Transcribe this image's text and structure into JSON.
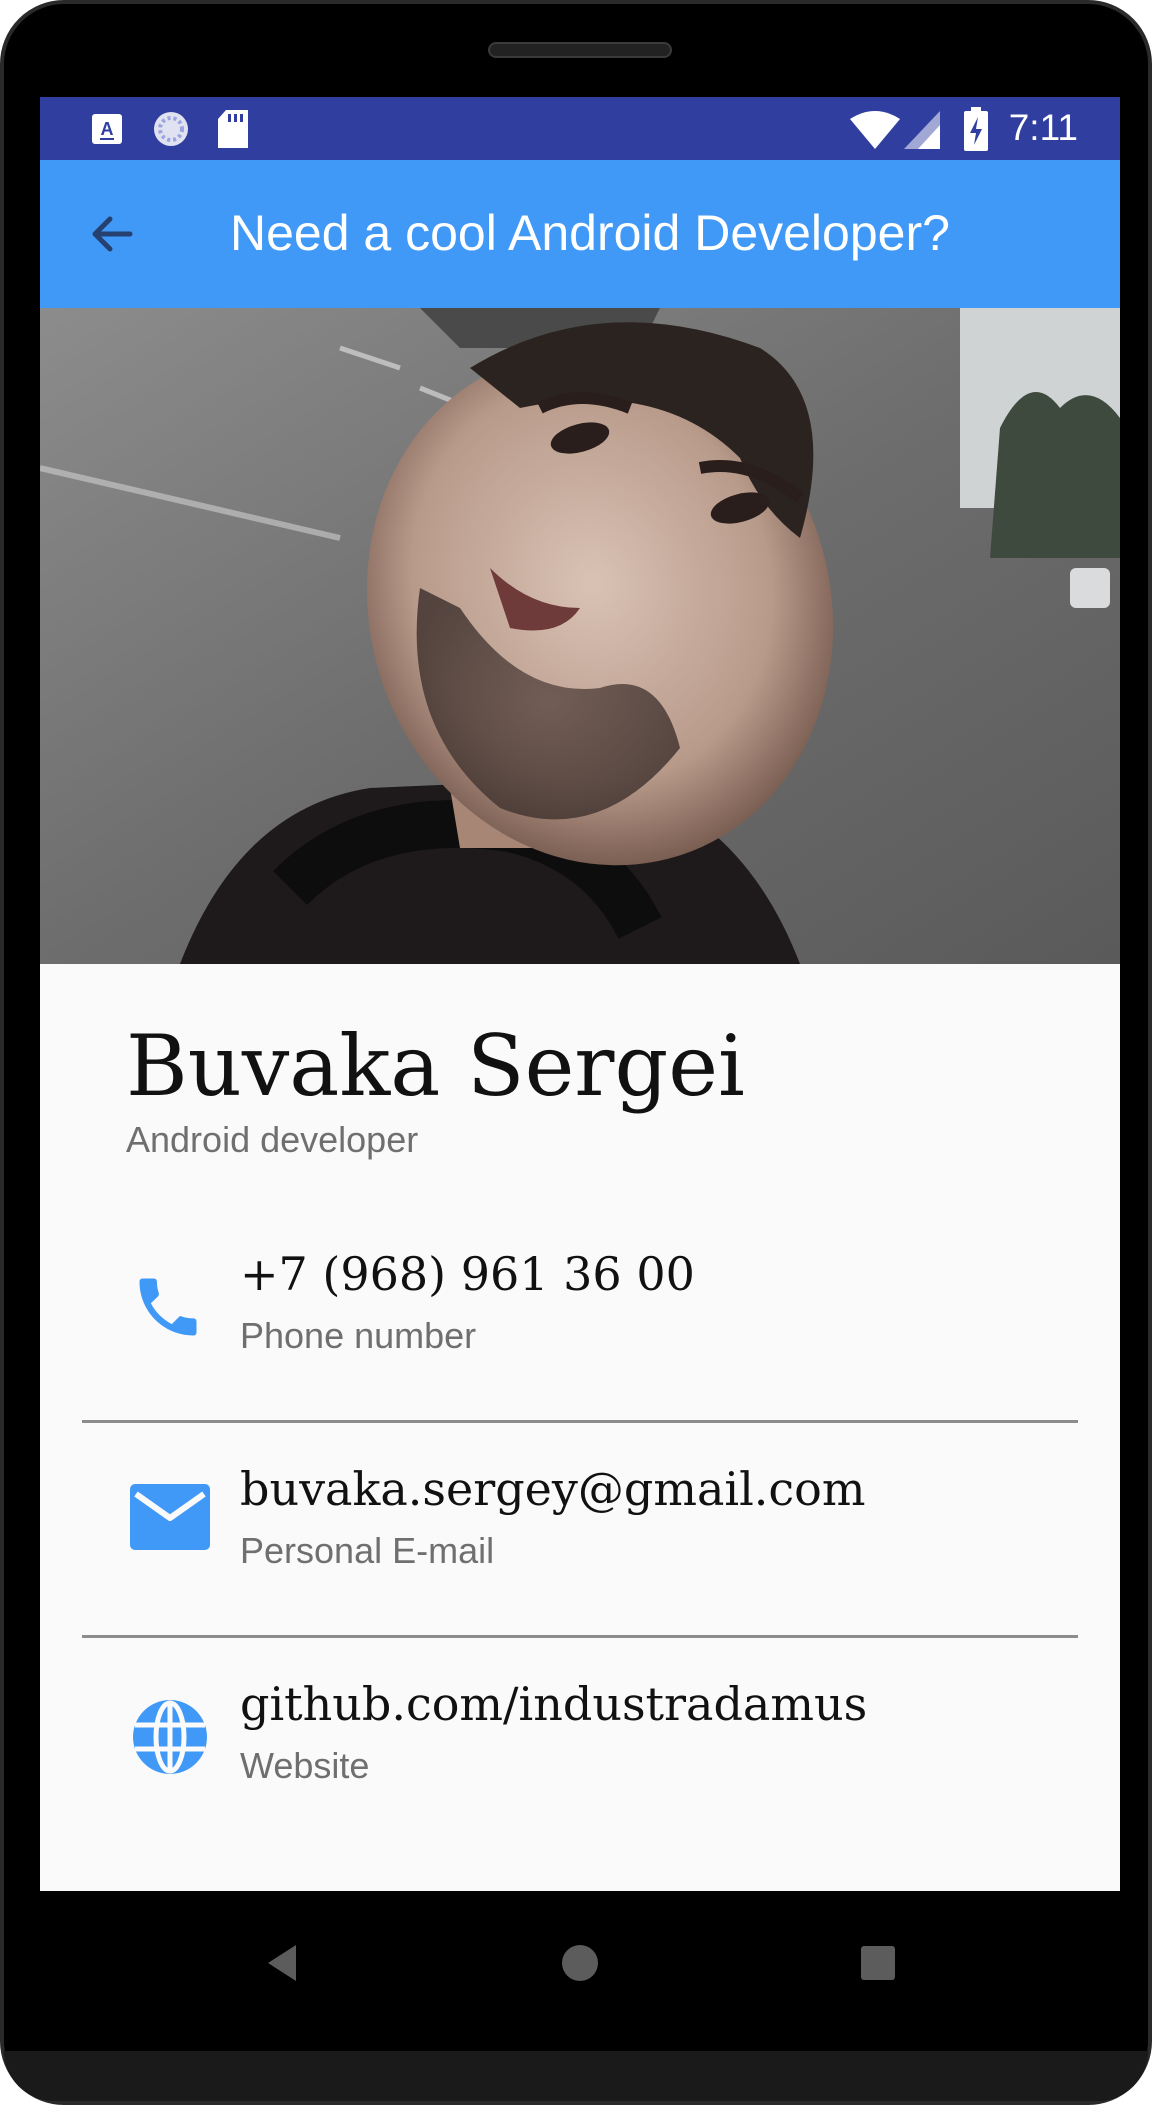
{
  "status_bar": {
    "time": "7:11",
    "left_icons": [
      "accessibility-a-icon",
      "loading-indicator-icon",
      "sd-card-icon"
    ],
    "right_icons": [
      "wifi-icon",
      "cell-signal-icon",
      "battery-charging-icon"
    ],
    "background": "#303f9f"
  },
  "app_bar": {
    "title": "Need a cool Android Developer?",
    "back_icon": "arrow-back-icon",
    "background": "#4199f7"
  },
  "profile": {
    "name": "Buvaka Sergei",
    "role": "Android developer"
  },
  "contacts": [
    {
      "icon": "phone-icon",
      "value": "+7 (968) 961 36 00",
      "label": "Phone number"
    },
    {
      "icon": "email-icon",
      "value": "buvaka.sergey@gmail.com",
      "label": "Personal E-mail"
    },
    {
      "icon": "globe-icon",
      "value": "github.com/industradamus",
      "label": "Website"
    }
  ],
  "nav_bar": {
    "buttons": [
      "back-triangle-icon",
      "home-circle-icon",
      "recents-square-icon"
    ]
  },
  "colors": {
    "accent": "#4199f7",
    "primary_dark": "#303f9f",
    "secondary_text": "#6f6f6f"
  }
}
